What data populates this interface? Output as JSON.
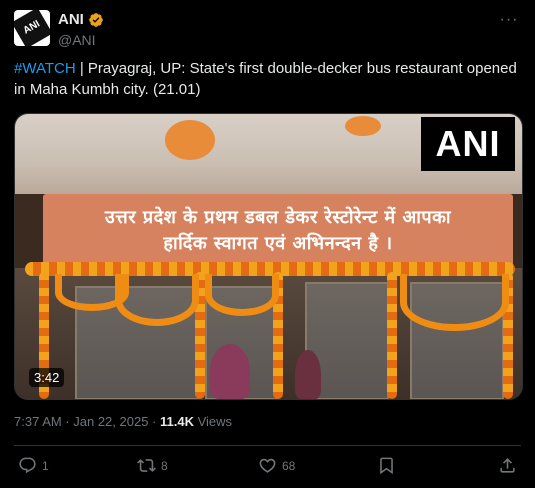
{
  "author": {
    "display_name": "ANI",
    "handle": "@ANI",
    "avatar_text": "ANI"
  },
  "tweet": {
    "hashtag": "#WATCH",
    "text": " | Prayagraj, UP: State's first double-decker bus restaurant opened in Maha Kumbh city. (21.01)"
  },
  "media": {
    "watermark": "ANI",
    "duration": "3:42",
    "banner_line1": "उत्तर प्रदेश के प्रथम डबल डेकर रेस्टोरेन्ट में आपका",
    "banner_line2": "हार्दिक स्वागत एवं अभिनन्दन है ।"
  },
  "meta": {
    "timestamp": "7:37 AM · Jan 22, 2025",
    "separator": " · ",
    "views_count": "11.4K",
    "views_label": " Views"
  },
  "actions": {
    "reply_count": "1",
    "retweet_count": "8",
    "like_count": "68"
  },
  "colors": {
    "background": "#000000",
    "accent": "#1d9bf0",
    "muted": "#71767b",
    "verified": "#e8a21c"
  }
}
